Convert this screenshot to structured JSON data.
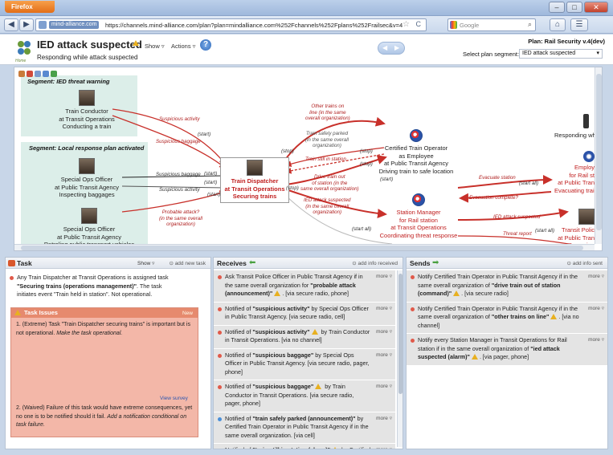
{
  "browser": {
    "app_button": "Firefox",
    "site_badge": "mind-alliance.com",
    "url": "https://channels.mind-alliance.com/plan?plan=mindalliance.com%252Fchannels%252Fplans%252Frailsec&v=4",
    "search_placeholder": "Google",
    "controls": [
      "◀",
      "▶"
    ],
    "window_controls": {
      "minimize": "–",
      "maximize": "□",
      "close": "✕"
    }
  },
  "header": {
    "logo_text": "Home",
    "title": "IED attack suspected",
    "subtitle": "Responding while attack suspected",
    "show_menu": "Show ▿",
    "actions_menu": "Actions ▿",
    "help": "?",
    "plan_name": "Plan: Rail Security v.4(dev)",
    "segment_label": "Select plan segment:",
    "segment_value": "IED attack suspected"
  },
  "flow": {
    "segments": [
      {
        "title": "Segment: IED threat warning"
      },
      {
        "title": "Segment: Local response plan activated"
      }
    ],
    "nodes": {
      "train_conductor": [
        "Train Conductor",
        "at Transit Operations",
        "Conducting a train"
      ],
      "special_ops_1": [
        "Special Ops Officer",
        "at Public Transit Agency",
        "Inspecting baggages"
      ],
      "special_ops_2": [
        "Special Ops Officer",
        "at Public Transit Agency",
        "Patroling public transport vehicles"
      ],
      "dispatcher": [
        "Train Dispatcher",
        "at Transit Operations",
        "Securing trains"
      ],
      "operator": [
        "Certified Train Operator",
        "as Employee",
        "at Public Transit Agency",
        "Driving train to safe location"
      ],
      "station_manager": [
        "Station Manager",
        "for Rail station",
        "at Transit Operations",
        "Coordinating threat response"
      ],
      "responding": [
        "Responding while at"
      ],
      "employee": [
        "Employ",
        "for Rail st",
        "at Public Tran",
        "Evacuating train"
      ],
      "transit_police": [
        "Transit Polic",
        "at Public Tran",
        "Sweeping"
      ]
    },
    "labels": {
      "suspicious_activity": "Suspicious activity",
      "suspicious_baggage": "Suspicious baggage",
      "suspicious_baggage_2": "Suspicious baggage",
      "suspicious_activity_2": "Suspicious activity",
      "probable_attack": [
        "Probable attack?",
        "(in the same overall",
        "organization)"
      ],
      "other_trains": [
        "Other trains on",
        "line (in the same",
        "overall organization)"
      ],
      "train_parked": [
        "Train safely parked",
        "(in the same overall",
        "organization)"
      ],
      "train_still": "Train still in station",
      "drive_out": [
        "Drive train out",
        "of station (in the",
        "same overall organization)"
      ],
      "ied_suspected": [
        "IED attack suspected",
        "(in the same overall",
        "organization)"
      ],
      "evacuate_station": "Evacuate station",
      "evacuation_complete": "Evacuation complete?",
      "ied_suspected_2": "IED attack suspected",
      "threat_report": "Threat report"
    },
    "small_labels": {
      "start": "(start)",
      "stop": "(stop)",
      "start_all": "(start all)"
    }
  },
  "task_panel": {
    "title": "Task",
    "show": "Show ▿",
    "add": "⊙ add new task",
    "description_pre": "Any Train Dispatcher at Transit Operations is assigned task",
    "description_bold": "\"Securing trains (operations management)\"",
    "description_post": ". The task initiates event \"Train held in station\". Not operational.",
    "issues_title": "Task Issues",
    "issues_new": "New",
    "issue_1_pre": "1.  (Extreme) Task \"Train Dispatcher securing trains\" is important but is not operational.",
    "issue_1_em": "Make the task operational.",
    "view_survey": "View survey",
    "issue_2_pre": "2.  (Waived) Failure of this task would have extreme consequences, yet no one is to be notified should it fail.",
    "issue_2_em": "Add a notification conditional on task failure."
  },
  "receives_panel": {
    "title": "Receives",
    "add": "⊙ add info received",
    "more": "more ▿",
    "items": [
      {
        "pre": "Ask Transit Police Officer in Public Transit Agency if in the same overall organization for ",
        "bold": "\"probable attack (announcement)\"",
        "post": ". [via secure radio, phone]",
        "warn": true,
        "bullet": "#e05a4a"
      },
      {
        "pre": "Notified of ",
        "bold": "\"suspicious activity\"",
        "post": " by Special Ops Officer in Public Transit Agency. [via secure radio, cell]",
        "warn": false,
        "bullet": "#e05a4a"
      },
      {
        "pre": "Notified of ",
        "bold": "\"suspicious activity\"",
        "post": " by Train Conductor in Transit Operations. [via no channel]",
        "warn": true,
        "bullet": "#e05a4a"
      },
      {
        "pre": "Notified of ",
        "bold": "\"suspicious baggage\"",
        "post": " by Special Ops Officer in Public Transit Agency. [via secure radio, pager, phone]",
        "warn": false,
        "bullet": "#e05a4a"
      },
      {
        "pre": "Notified of ",
        "bold": "\"suspicious baggage\"",
        "post": " by Train Conductor in Transit Operations. [via secure radio, pager, phone]",
        "warn": true,
        "bullet": "#e05a4a"
      },
      {
        "pre": "Notified of ",
        "bold": "\"train safely parked (announcement)\"",
        "post": " by Certified Train Operator in Public Transit Agency if in the same overall organization. [via cell]",
        "warn": false,
        "bullet": "#4a8fd8"
      },
      {
        "pre": "Notified of ",
        "bold": "\"train still in station (alarm)\"",
        "post": " by Certified Train Operator in Public Transit Agency. [via radio]",
        "warn": true,
        "bullet": "#4a8fd8"
      }
    ]
  },
  "sends_panel": {
    "title": "Sends",
    "add": "⊙ add info sent",
    "more": "more ▿",
    "items": [
      {
        "pre": "Notify Certified Train Operator in Public Transit Agency if in the same overall organization of ",
        "bold": "\"drive train out of station (command)\"",
        "post": ". [via secure radio]",
        "warn": true
      },
      {
        "pre": "Notify Certified Train Operator in Public Transit Agency if in the same overall organization of ",
        "bold": "\"other trains on line\"",
        "post": ". [via no channel]",
        "warn": true
      },
      {
        "pre": "Notify every Station Manager in Transit Operations for Rail station if in the same overall organization of ",
        "bold": "\"ied attack suspected (alarm)\"",
        "post": ". [via pager, phone]",
        "warn": true
      }
    ]
  },
  "colors": {
    "flow_red": "#c8302a",
    "segment_bg": "#dceee9",
    "issues_bg": "#f3b7a8",
    "issues_head": "#e68a6e"
  }
}
